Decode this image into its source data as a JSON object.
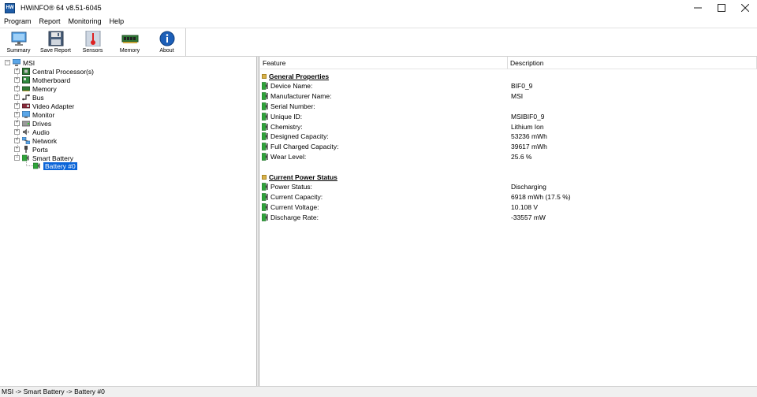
{
  "window": {
    "title": "HWiNFO® 64 v8.51-6045",
    "icon_text": "HW"
  },
  "menu": [
    "Program",
    "Report",
    "Monitoring",
    "Help"
  ],
  "toolbar": [
    {
      "label": "Summary",
      "icon": "monitor-icon"
    },
    {
      "label": "Save Report",
      "icon": "floppy-disk-icon"
    },
    {
      "label": "Sensors",
      "icon": "thermometer-icon"
    },
    {
      "label": "Memory",
      "icon": "memory-module-icon"
    },
    {
      "label": "About",
      "icon": "info-icon"
    }
  ],
  "tree": {
    "root": "MSI",
    "items": [
      {
        "label": "Central Processor(s)",
        "icon": "cpu-icon"
      },
      {
        "label": "Motherboard",
        "icon": "motherboard-icon"
      },
      {
        "label": "Memory",
        "icon": "memory-icon"
      },
      {
        "label": "Bus",
        "icon": "bus-icon"
      },
      {
        "label": "Video Adapter",
        "icon": "video-adapter-icon"
      },
      {
        "label": "Monitor",
        "icon": "monitor-icon"
      },
      {
        "label": "Drives",
        "icon": "drive-icon"
      },
      {
        "label": "Audio",
        "icon": "speaker-icon"
      },
      {
        "label": "Network",
        "icon": "network-icon"
      },
      {
        "label": "Ports",
        "icon": "port-icon"
      },
      {
        "label": "Smart Battery",
        "icon": "battery-icon"
      }
    ],
    "child": "Battery #0"
  },
  "columns": {
    "feature": "Feature",
    "description": "Description"
  },
  "sections": [
    {
      "title": "General Properties",
      "rows": [
        {
          "feature": "Device Name:",
          "value": "BIF0_9"
        },
        {
          "feature": "Manufacturer Name:",
          "value": "MSI"
        },
        {
          "feature": "Serial Number:",
          "value": ""
        },
        {
          "feature": "Unique ID:",
          "value": "MSIBIF0_9"
        },
        {
          "feature": "Chemistry:",
          "value": "Lithium Ion"
        },
        {
          "feature": "Designed Capacity:",
          "value": "53236 mWh"
        },
        {
          "feature": "Full Charged Capacity:",
          "value": "39617 mWh"
        },
        {
          "feature": "Wear Level:",
          "value": "25.6 %"
        }
      ]
    },
    {
      "title": "Current Power Status",
      "rows": [
        {
          "feature": "Power Status:",
          "value": "Discharging"
        },
        {
          "feature": "Current Capacity:",
          "value": "6918 mWh (17.5 %)"
        },
        {
          "feature": "Current Voltage:",
          "value": "10.108 V"
        },
        {
          "feature": "Discharge Rate:",
          "value": "-33557 mW"
        }
      ]
    }
  ],
  "status_bar": "MSI -> Smart Battery -> Battery #0",
  "colors": {
    "selection": "#0a64d8",
    "battery_green": "#2fa33a"
  }
}
